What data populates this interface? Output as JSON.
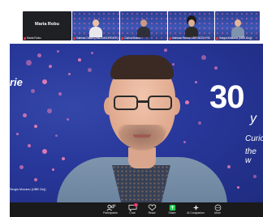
{
  "meeting": {
    "thumbnails": [
      {
        "big_name": "Maria Robu",
        "label": "Maria Robu",
        "muted": true
      },
      {
        "label": "Sabina Crisan (ANCA INCREATE)",
        "muted": true
      },
      {
        "label": "Corina Barna",
        "muted": true
      },
      {
        "label": "Adriana Rohar, UEFISCDI, RO",
        "muted": true
      },
      {
        "label": "Sergiu Mocanu (UBB Cluj)",
        "muted": true
      }
    ],
    "active_speaker_label": "Sergiu Mocanu (UBB Cluj)"
  },
  "background": {
    "wordmark": "rie",
    "big_number": "30",
    "years_text": "y",
    "line1": "Curio",
    "line2": "the w"
  },
  "toolbar": {
    "participants_label": "Participants",
    "participants_count": "35",
    "chat_label": "Chat",
    "chat_badge": "1",
    "react_label": "React",
    "share_label": "Share",
    "ai_companion_label": "AI Companion",
    "more_label": "More"
  },
  "colors": {
    "stage_bg": "#27368f",
    "dot_pink": "#ee7fb4",
    "toolbar_bg": "#1a1a1a",
    "share_green": "#1ecb52",
    "alert_red": "#e0245e"
  }
}
